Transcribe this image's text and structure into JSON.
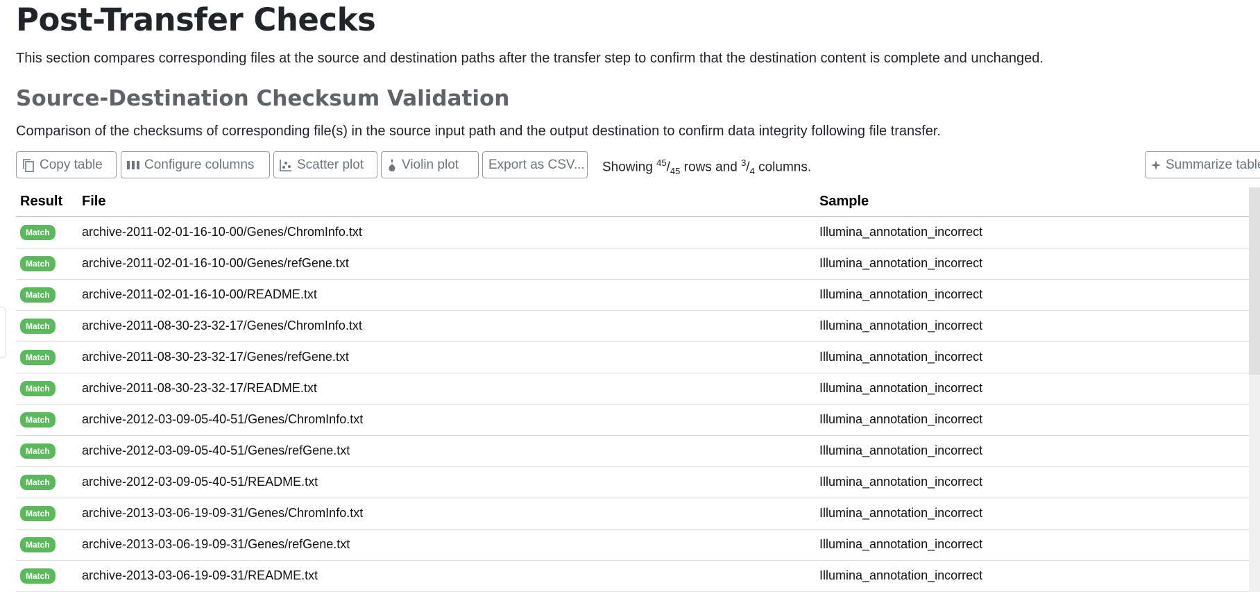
{
  "page": {
    "title": "Post-Transfer Checks",
    "intro": "This section compares corresponding files at the source and destination paths after the transfer step to confirm that the destination content is complete and unchanged."
  },
  "section": {
    "title": "Source-Destination Checksum Validation",
    "description": "Comparison of the checksums of corresponding file(s) in the source input path and the output destination to confirm data integrity following file transfer."
  },
  "toolbar": {
    "copy_label": "Copy table",
    "configure_label": "Configure columns",
    "scatter_label": "Scatter plot",
    "violin_label": "Violin plot",
    "export_label": "Export as CSV...",
    "summarize_label": "Summarize table",
    "showing_prefix": "Showing",
    "rows_shown": "45",
    "rows_total": "45",
    "rows_word": "rows and",
    "cols_shown": "3",
    "cols_total": "4",
    "cols_word": "columns."
  },
  "table": {
    "headers": [
      "Result",
      "File",
      "Sample"
    ],
    "rows": [
      {
        "result": "Match",
        "file": "archive-2011-02-01-16-10-00/Genes/ChromInfo.txt",
        "sample": "Illumina_annotation_incorrect"
      },
      {
        "result": "Match",
        "file": "archive-2011-02-01-16-10-00/Genes/refGene.txt",
        "sample": "Illumina_annotation_incorrect"
      },
      {
        "result": "Match",
        "file": "archive-2011-02-01-16-10-00/README.txt",
        "sample": "Illumina_annotation_incorrect"
      },
      {
        "result": "Match",
        "file": "archive-2011-08-30-23-32-17/Genes/ChromInfo.txt",
        "sample": "Illumina_annotation_incorrect"
      },
      {
        "result": "Match",
        "file": "archive-2011-08-30-23-32-17/Genes/refGene.txt",
        "sample": "Illumina_annotation_incorrect"
      },
      {
        "result": "Match",
        "file": "archive-2011-08-30-23-32-17/README.txt",
        "sample": "Illumina_annotation_incorrect"
      },
      {
        "result": "Match",
        "file": "archive-2012-03-09-05-40-51/Genes/ChromInfo.txt",
        "sample": "Illumina_annotation_incorrect"
      },
      {
        "result": "Match",
        "file": "archive-2012-03-09-05-40-51/Genes/refGene.txt",
        "sample": "Illumina_annotation_incorrect"
      },
      {
        "result": "Match",
        "file": "archive-2012-03-09-05-40-51/README.txt",
        "sample": "Illumina_annotation_incorrect"
      },
      {
        "result": "Match",
        "file": "archive-2013-03-06-19-09-31/Genes/ChromInfo.txt",
        "sample": "Illumina_annotation_incorrect"
      },
      {
        "result": "Match",
        "file": "archive-2013-03-06-19-09-31/Genes/refGene.txt",
        "sample": "Illumina_annotation_incorrect"
      },
      {
        "result": "Match",
        "file": "archive-2013-03-06-19-09-31/README.txt",
        "sample": "Illumina_annotation_incorrect"
      }
    ]
  },
  "colors": {
    "match_badge": "#5cb85c",
    "heading_gray": "#5f6266"
  },
  "icons": [
    "copy-icon",
    "columns-icon",
    "scatter-icon",
    "violin-icon",
    "sparkle-icon"
  ]
}
